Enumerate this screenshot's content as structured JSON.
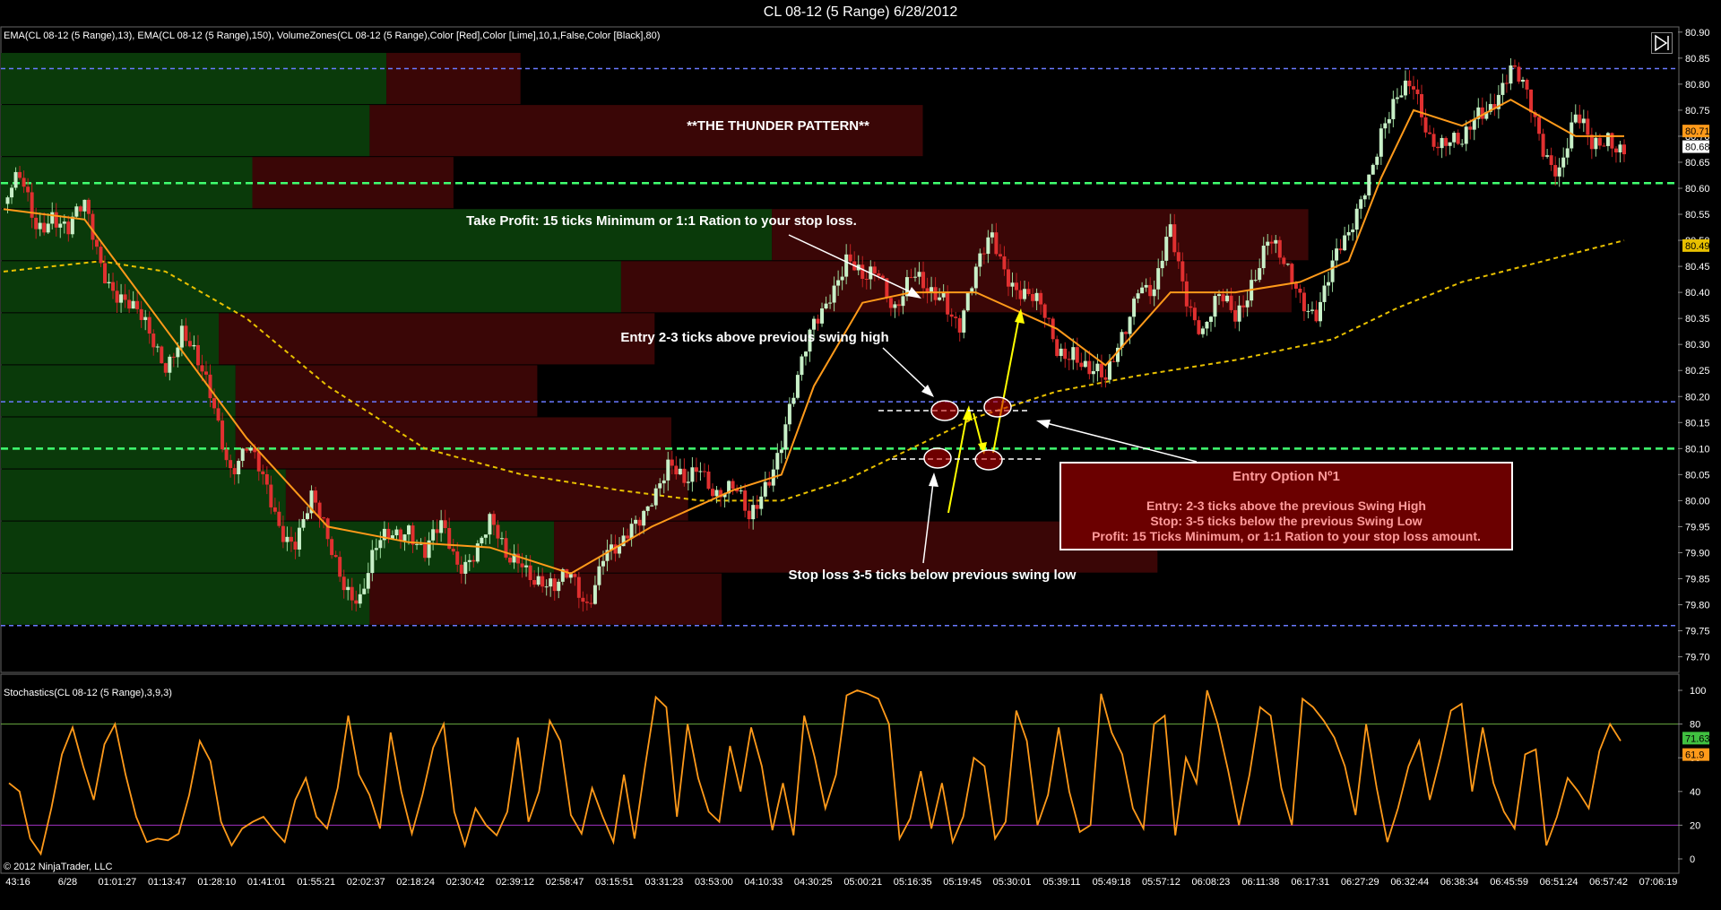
{
  "window_title": "CL 08-12 (5 Range)  6/28/2012",
  "indicator_label": "EMA(CL 08-12 (5 Range),13), EMA(CL 08-12 (5 Range),150), VolumeZones(CL 08-12 (5 Range),Color [Red],Color [Lime],10,1,False,Color [Black],80)",
  "stoch_label": "Stochastics(CL 08-12 (5 Range),3,9,3)",
  "copyright": "© 2012 NinjaTrader, LLC",
  "annotations": {
    "pattern_title": "**THE THUNDER PATTERN**",
    "take_profit": "Take Profit: 15 ticks Minimum or 1:1 Ration to your stop loss.",
    "entry_note": "Entry 2-3 ticks above previous swing high",
    "stop_note": "Stop loss 3-5 ticks below previous swing low"
  },
  "entry_box": {
    "heading": "Entry Option Nº1",
    "line1": "Entry: 2-3 ticks above the previous Swing High",
    "line2": "Stop: 3-5 ticks below the previous Swing Low",
    "line3": "Profit: 15 Ticks Minimum, or 1:1 Ration to your stop loss amount."
  },
  "colors": {
    "up_candle": "#c8f0c8",
    "down_candle": "#e03030",
    "ema_fast": "#ff9a1a",
    "ema_slow": "#e8c000",
    "volume_up": "#0a3a0a",
    "volume_down": "#3a0606",
    "stoch": "#ff9a1a",
    "level_blue": "#6a7aff",
    "level_green": "#40ff70"
  },
  "chart_data": {
    "type": "candlestick",
    "price_axis": {
      "ylim": [
        79.67,
        80.91
      ],
      "ticks": [
        "80.90",
        "80.85",
        "80.80",
        "80.75",
        "80.70",
        "80.65",
        "80.60",
        "80.55",
        "80.50",
        "80.45",
        "80.40",
        "80.35",
        "80.30",
        "80.25",
        "80.20",
        "80.15",
        "80.10",
        "80.05",
        "80.00",
        "79.95",
        "79.90",
        "79.85",
        "79.80",
        "79.75",
        "79.70"
      ],
      "badges": [
        {
          "label": "80.71",
          "value": 80.71,
          "color": "#ff9a1a"
        },
        {
          "label": "80.68",
          "value": 80.68,
          "color": "#ffffff"
        },
        {
          "label": "80.49",
          "value": 80.49,
          "color": "#e8c000"
        }
      ]
    },
    "time_axis": [
      "43:16",
      "6/28",
      "01:01:27",
      "01:13:47",
      "01:28:10",
      "01:41:01",
      "01:55:21",
      "02:02:37",
      "02:18:24",
      "02:30:42",
      "02:39:12",
      "02:58:47",
      "03:15:51",
      "03:31:23",
      "03:53:00",
      "04:10:33",
      "04:30:25",
      "05:00:21",
      "05:16:35",
      "05:19:45",
      "05:30:01",
      "05:39:11",
      "05:49:18",
      "05:57:12",
      "06:08:23",
      "06:11:38",
      "06:17:31",
      "06:27:29",
      "06:32:44",
      "06:38:34",
      "06:45:59",
      "06:51:24",
      "06:57:42",
      "07:06:19"
    ],
    "levels": [
      {
        "value": 80.83,
        "style": "blue-dashed"
      },
      {
        "value": 80.61,
        "style": "green-dashed"
      },
      {
        "value": 80.19,
        "style": "blue-dashed"
      },
      {
        "value": 80.1,
        "style": "green-dashed"
      },
      {
        "value": 79.76,
        "style": "blue-dashed"
      }
    ],
    "close_path": [
      [
        0,
        80.57
      ],
      [
        10,
        80.6
      ],
      [
        20,
        80.53
      ],
      [
        30,
        80.57
      ],
      [
        40,
        80.51
      ],
      [
        50,
        80.55
      ],
      [
        60,
        80.47
      ],
      [
        70,
        80.41
      ],
      [
        80,
        80.35
      ],
      [
        90,
        80.31
      ],
      [
        100,
        80.28
      ],
      [
        110,
        80.33
      ],
      [
        120,
        80.24
      ],
      [
        130,
        80.18
      ],
      [
        140,
        80.08
      ],
      [
        150,
        80.1
      ],
      [
        160,
        80.02
      ],
      [
        170,
        79.96
      ],
      [
        180,
        79.94
      ],
      [
        190,
        79.99
      ],
      [
        200,
        79.91
      ],
      [
        210,
        79.86
      ],
      [
        220,
        79.82
      ],
      [
        230,
        79.89
      ],
      [
        240,
        79.93
      ],
      [
        250,
        79.97
      ],
      [
        260,
        79.9
      ],
      [
        270,
        79.93
      ],
      [
        280,
        79.88
      ],
      [
        290,
        79.92
      ],
      [
        300,
        79.95
      ],
      [
        310,
        79.87
      ],
      [
        320,
        79.9
      ],
      [
        330,
        79.86
      ],
      [
        340,
        79.81
      ],
      [
        350,
        79.85
      ],
      [
        360,
        79.82
      ],
      [
        370,
        79.9
      ],
      [
        380,
        79.88
      ],
      [
        390,
        79.96
      ],
      [
        400,
        80.03
      ],
      [
        410,
        80.06
      ],
      [
        420,
        80.01
      ],
      [
        430,
        80.08
      ],
      [
        440,
        80.03
      ],
      [
        450,
        80.01
      ],
      [
        460,
        79.95
      ],
      [
        470,
        80.05
      ],
      [
        480,
        80.12
      ],
      [
        490,
        80.21
      ],
      [
        500,
        80.34
      ],
      [
        510,
        80.42
      ],
      [
        520,
        80.46
      ],
      [
        530,
        80.4
      ],
      [
        540,
        80.45
      ],
      [
        550,
        80.39
      ],
      [
        560,
        80.42
      ],
      [
        570,
        80.38
      ],
      [
        580,
        80.41
      ],
      [
        590,
        80.35
      ],
      [
        600,
        80.42
      ],
      [
        610,
        80.5
      ],
      [
        620,
        80.45
      ],
      [
        630,
        80.4
      ],
      [
        640,
        80.35
      ],
      [
        650,
        80.29
      ],
      [
        660,
        80.31
      ],
      [
        670,
        80.24
      ],
      [
        680,
        80.21
      ],
      [
        690,
        80.33
      ],
      [
        700,
        80.43
      ],
      [
        710,
        80.38
      ],
      [
        720,
        80.51
      ],
      [
        730,
        80.41
      ],
      [
        740,
        80.33
      ],
      [
        750,
        80.37
      ],
      [
        760,
        80.35
      ],
      [
        770,
        80.44
      ],
      [
        780,
        80.5
      ],
      [
        790,
        80.43
      ],
      [
        800,
        80.4
      ],
      [
        810,
        80.38
      ],
      [
        820,
        80.44
      ],
      [
        830,
        80.49
      ],
      [
        840,
        80.62
      ],
      [
        850,
        80.72
      ],
      [
        860,
        80.75
      ],
      [
        870,
        80.79
      ],
      [
        880,
        80.72
      ],
      [
        890,
        80.69
      ],
      [
        900,
        80.66
      ],
      [
        910,
        80.75
      ],
      [
        920,
        80.79
      ],
      [
        930,
        80.82
      ],
      [
        940,
        80.76
      ],
      [
        950,
        80.69
      ],
      [
        960,
        80.65
      ],
      [
        970,
        80.72
      ],
      [
        980,
        80.67
      ],
      [
        990,
        80.72
      ],
      [
        1000,
        80.68
      ]
    ],
    "ema_fast": [
      [
        0,
        80.56
      ],
      [
        50,
        80.54
      ],
      [
        100,
        80.33
      ],
      [
        150,
        80.12
      ],
      [
        200,
        79.95
      ],
      [
        250,
        79.92
      ],
      [
        300,
        79.91
      ],
      [
        350,
        79.86
      ],
      [
        400,
        79.95
      ],
      [
        450,
        80.02
      ],
      [
        480,
        80.05
      ],
      [
        500,
        80.22
      ],
      [
        530,
        80.38
      ],
      [
        560,
        80.4
      ],
      [
        600,
        80.4
      ],
      [
        650,
        80.33
      ],
      [
        680,
        80.26
      ],
      [
        720,
        80.4
      ],
      [
        760,
        80.4
      ],
      [
        800,
        80.42
      ],
      [
        830,
        80.46
      ],
      [
        850,
        80.62
      ],
      [
        870,
        80.75
      ],
      [
        900,
        80.72
      ],
      [
        930,
        80.77
      ],
      [
        970,
        80.7
      ],
      [
        1000,
        80.7
      ]
    ],
    "ema_slow": [
      [
        0,
        80.44
      ],
      [
        60,
        80.46
      ],
      [
        100,
        80.44
      ],
      [
        150,
        80.35
      ],
      [
        200,
        80.22
      ],
      [
        260,
        80.1
      ],
      [
        320,
        80.05
      ],
      [
        380,
        80.02
      ],
      [
        430,
        80.0
      ],
      [
        480,
        80.0
      ],
      [
        520,
        80.04
      ],
      [
        560,
        80.1
      ],
      [
        600,
        80.16
      ],
      [
        650,
        80.21
      ],
      [
        700,
        80.24
      ],
      [
        760,
        80.27
      ],
      [
        820,
        80.31
      ],
      [
        860,
        80.37
      ],
      [
        900,
        80.42
      ],
      [
        950,
        80.46
      ],
      [
        1000,
        80.5
      ]
    ],
    "volume_zones": [
      {
        "top": 80.86,
        "bottom": 80.76,
        "up": 0.23,
        "down": 0.08
      },
      {
        "top": 80.76,
        "bottom": 80.66,
        "up": 0.22,
        "down": 0.33
      },
      {
        "top": 80.66,
        "bottom": 80.56,
        "up": 0.15,
        "down": 0.12
      },
      {
        "top": 80.56,
        "bottom": 80.46,
        "up": 0.46,
        "down": 0.32
      },
      {
        "top": 80.46,
        "bottom": 80.36,
        "up": 0.37,
        "down": 0.4
      },
      {
        "top": 80.36,
        "bottom": 80.26,
        "up": 0.13,
        "down": 0.26
      },
      {
        "top": 80.26,
        "bottom": 80.16,
        "up": 0.14,
        "down": 0.18
      },
      {
        "top": 80.16,
        "bottom": 80.06,
        "up": 0.14,
        "down": 0.26
      },
      {
        "top": 80.06,
        "bottom": 79.96,
        "up": 0.17,
        "down": 0.24
      },
      {
        "top": 79.96,
        "bottom": 79.86,
        "up": 0.33,
        "down": 0.36
      },
      {
        "top": 79.86,
        "bottom": 79.76,
        "up": 0.22,
        "down": 0.21
      }
    ],
    "stochastics": {
      "ylim": [
        0,
        100
      ],
      "ticks": [
        "100",
        "80",
        "60",
        "40",
        "20",
        "0"
      ],
      "overbought": 80,
      "oversold": 20,
      "badges": [
        {
          "label": "71.63",
          "value": 71.63,
          "color": "#40c040"
        },
        {
          "label": "61.9",
          "value": 61.9,
          "color": "#ff9a1a"
        }
      ],
      "values": [
        45,
        40,
        12,
        3,
        30,
        62,
        78,
        55,
        35,
        68,
        80,
        50,
        25,
        10,
        12,
        11,
        15,
        38,
        70,
        58,
        22,
        8,
        18,
        22,
        25,
        17,
        10,
        35,
        48,
        25,
        18,
        42,
        85,
        50,
        38,
        18,
        75,
        40,
        15,
        38,
        66,
        80,
        28,
        8,
        30,
        20,
        14,
        28,
        72,
        22,
        40,
        82,
        70,
        26,
        15,
        42,
        25,
        10,
        50,
        12,
        55,
        96,
        90,
        25,
        80,
        48,
        28,
        22,
        67,
        40,
        78,
        55,
        17,
        45,
        14,
        85,
        60,
        30,
        50,
        97,
        100,
        98,
        95,
        80,
        12,
        24,
        52,
        18,
        45,
        10,
        25,
        60,
        55,
        12,
        22,
        88,
        70,
        20,
        38,
        78,
        40,
        16,
        20,
        98,
        75,
        62,
        30,
        18,
        80,
        85,
        14,
        60,
        45,
        100,
        80,
        52,
        20,
        50,
        90,
        85,
        42,
        20,
        95,
        90,
        82,
        72,
        55,
        26,
        80,
        42,
        10,
        30,
        55,
        70,
        35,
        60,
        88,
        92,
        40,
        78,
        45,
        28,
        18,
        62,
        65,
        8,
        25,
        48,
        40,
        30,
        64,
        80,
        70
      ]
    }
  }
}
